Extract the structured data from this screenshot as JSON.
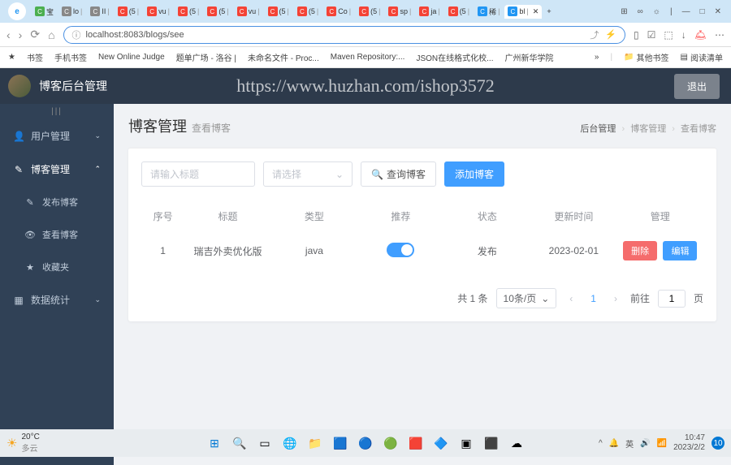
{
  "browser": {
    "tabs": [
      {
        "favicon": "green",
        "text": "宝"
      },
      {
        "favicon": "gray",
        "text": "lo"
      },
      {
        "favicon": "gray",
        "text": "II"
      },
      {
        "favicon": "red",
        "text": "(5"
      },
      {
        "favicon": "red",
        "text": "vu"
      },
      {
        "favicon": "red",
        "text": "(5"
      },
      {
        "favicon": "red",
        "text": "(5"
      },
      {
        "favicon": "red",
        "text": "vu"
      },
      {
        "favicon": "red",
        "text": "(5"
      },
      {
        "favicon": "red",
        "text": "(5"
      },
      {
        "favicon": "red",
        "text": "Co"
      },
      {
        "favicon": "red",
        "text": "(5"
      },
      {
        "favicon": "red",
        "text": "sp"
      },
      {
        "favicon": "red",
        "text": "ja"
      },
      {
        "favicon": "red",
        "text": "(5"
      },
      {
        "favicon": "blue",
        "text": "稀"
      },
      {
        "favicon": "blue",
        "text": "bl",
        "active": true
      }
    ],
    "url": "localhost:8083/blogs/see",
    "bookmarks": [
      "书签",
      "手机书签",
      "New Online Judge",
      "题单广场 - 洛谷 |",
      "未命名文件 - Proc...",
      "Maven Repository:...",
      "JSON在线格式化校...",
      "广州新华学院"
    ],
    "bookmarks_right": [
      "其他书签",
      "阅读清单"
    ]
  },
  "header": {
    "title": "博客后台管理",
    "watermark": "https://www.huzhan.com/ishop3572",
    "logout": "退出"
  },
  "sidebar": {
    "items": [
      {
        "icon": "👤",
        "label": "用户管理",
        "arrow": "⌄"
      },
      {
        "icon": "✎",
        "label": "博客管理",
        "arrow": "⌃",
        "expanded": true
      },
      {
        "icon": "✎",
        "label": "发布博客",
        "sub": true
      },
      {
        "icon": "👁",
        "label": "查看博客",
        "sub": true
      },
      {
        "icon": "★",
        "label": "收藏夹",
        "sub": true
      },
      {
        "icon": "▦",
        "label": "数据统计",
        "arrow": "⌄"
      }
    ]
  },
  "page": {
    "title": "博客管理",
    "subtitle": "查看博客",
    "breadcrumb": [
      "后台管理",
      "博客管理",
      "查看博客"
    ]
  },
  "search": {
    "title_placeholder": "请输入标题",
    "select_placeholder": "请选择",
    "search_btn": "查询博客",
    "add_btn": "添加博客"
  },
  "table": {
    "headers": [
      "序号",
      "标题",
      "类型",
      "推荐",
      "状态",
      "更新时间",
      "管理"
    ],
    "rows": [
      {
        "id": "1",
        "title": "瑞吉外卖优化版",
        "type": "java",
        "recommend": true,
        "status": "发布",
        "time": "2023-02-01"
      }
    ],
    "delete_btn": "删除",
    "edit_btn": "编辑"
  },
  "pagination": {
    "total": "共 1 条",
    "per_page": "10条/页",
    "current": "1",
    "goto": "前往",
    "goto_val": "1",
    "page_suffix": "页"
  },
  "taskbar": {
    "weather_temp": "20°C",
    "weather_desc": "多云",
    "tray": [
      "^",
      "🔔",
      "英",
      "🔊",
      "📶"
    ],
    "time": "10:47",
    "date": "2023/2/2"
  }
}
